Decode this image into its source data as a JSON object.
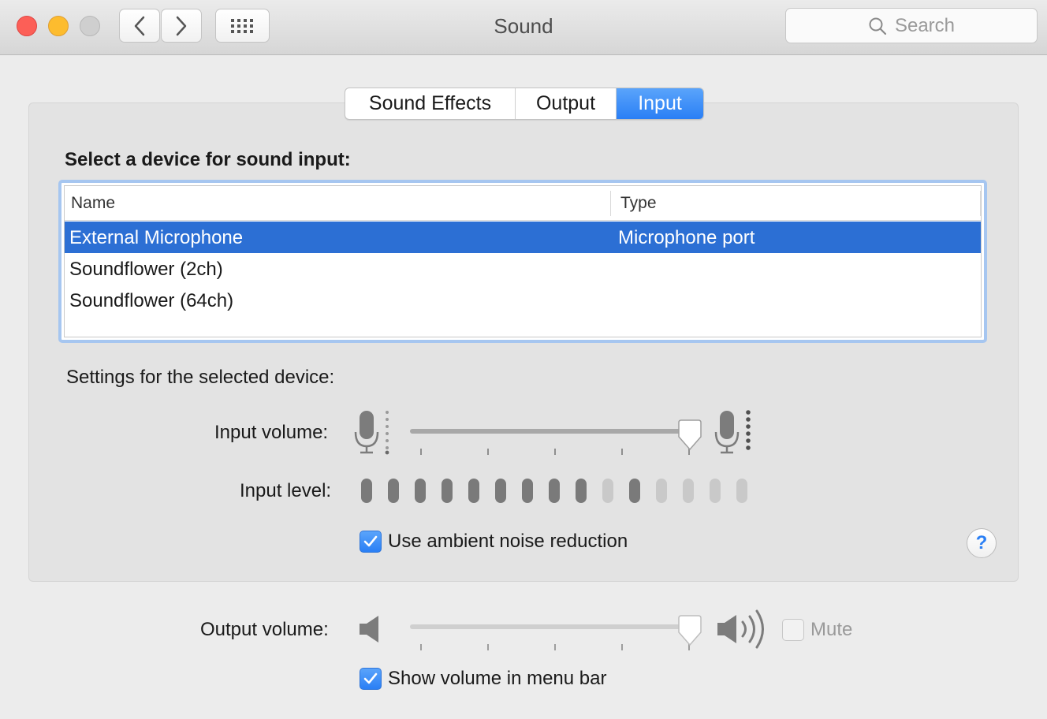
{
  "window": {
    "title": "Sound"
  },
  "search": {
    "placeholder": "Search",
    "icon": "search-icon"
  },
  "toolbar": {
    "back_icon": "chevron-left-icon",
    "forward_icon": "chevron-right-icon",
    "grid_icon": "grid-icon"
  },
  "tabs": [
    {
      "label": "Sound Effects",
      "active": false
    },
    {
      "label": "Output",
      "active": false
    },
    {
      "label": "Input",
      "active": true
    }
  ],
  "input": {
    "heading": "Select a device for sound input:",
    "columns": [
      "Name",
      "Type"
    ],
    "devices": [
      {
        "name": "External Microphone",
        "type": "Microphone port",
        "selected": true
      },
      {
        "name": "Soundflower (2ch)",
        "type": "",
        "selected": false
      },
      {
        "name": "Soundflower (64ch)",
        "type": "",
        "selected": false
      }
    ],
    "settings_heading": "Settings for the selected device:",
    "volume_label": "Input volume:",
    "volume_level": 0.97,
    "level_label": "Input level:",
    "level_segments": 15,
    "level_active": [
      true,
      true,
      true,
      true,
      true,
      true,
      true,
      true,
      true,
      false,
      true,
      false,
      false,
      false,
      false
    ],
    "noise_reduction_label": "Use ambient noise reduction",
    "noise_reduction_checked": true
  },
  "output": {
    "volume_label": "Output volume:",
    "volume_level": 0.97,
    "mute_label": "Mute",
    "mute_checked": false,
    "menubar_label": "Show volume in menu bar",
    "menubar_checked": true
  },
  "help": {
    "label": "?"
  },
  "colors": {
    "accent": "#2a7ff5",
    "selection": "#2c6fd4",
    "close": "#fc5f57",
    "minimize": "#fdbc2e"
  }
}
